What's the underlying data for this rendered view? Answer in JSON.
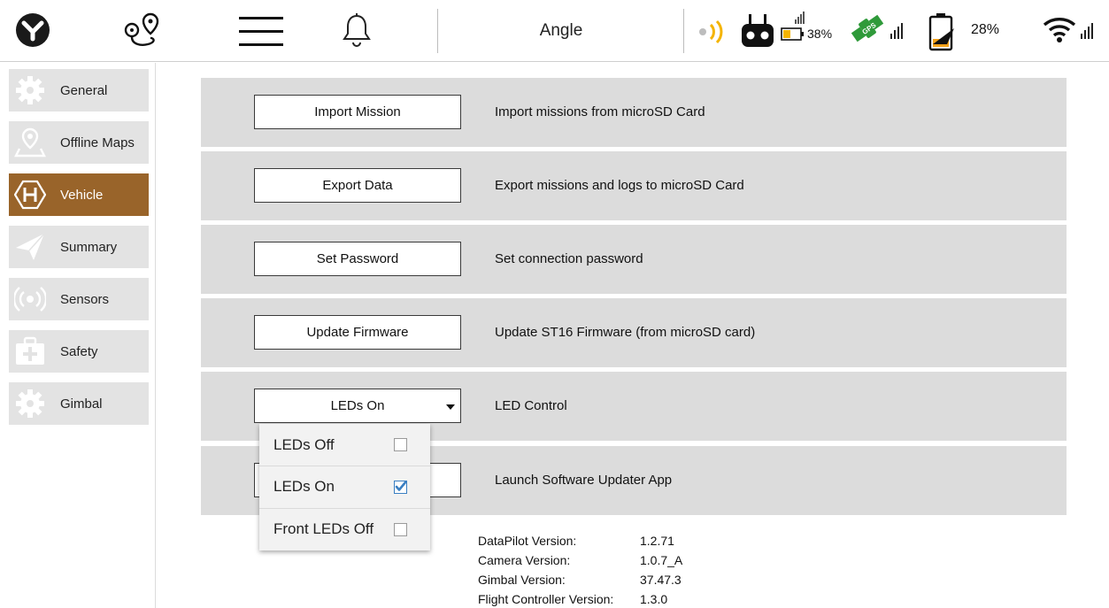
{
  "header": {
    "title": "Angle",
    "status": {
      "remote_battery": "38%",
      "gps_label": "GPS",
      "device_battery": "28%"
    },
    "colors": {
      "accent": "#99642a",
      "battery_low": "#f4b400",
      "gps_green": "#2f9a3a",
      "check_blue": "#3a7fc2"
    }
  },
  "sidebar": {
    "items": [
      {
        "label": "General",
        "icon": "gear-icon",
        "active": false
      },
      {
        "label": "Offline Maps",
        "icon": "map-pin-icon",
        "active": false
      },
      {
        "label": "Vehicle",
        "icon": "hexacopter-icon",
        "active": true
      },
      {
        "label": "Summary",
        "icon": "paper-plane-icon",
        "active": false
      },
      {
        "label": "Sensors",
        "icon": "broadcast-icon",
        "active": false
      },
      {
        "label": "Safety",
        "icon": "first-aid-kit-icon",
        "active": false
      },
      {
        "label": "Gimbal",
        "icon": "gear-icon",
        "active": false
      }
    ]
  },
  "main": {
    "rows": [
      {
        "button": "Import Mission",
        "description": "Import missions from microSD Card"
      },
      {
        "button": "Export Data",
        "description": "Export missions and logs to microSD Card"
      },
      {
        "button": "Set Password",
        "description": "Set connection password"
      },
      {
        "button": "Update Firmware",
        "description": "Update ST16 Firmware (from microSD card)"
      },
      {
        "select_value": "LEDs On",
        "description": "LED Control"
      },
      {
        "button": "",
        "description": "Launch Software Updater App"
      }
    ],
    "led_menu": {
      "options": [
        {
          "label": "LEDs Off",
          "checked": false
        },
        {
          "label": "LEDs On",
          "checked": true
        },
        {
          "label": "Front LEDs Off",
          "checked": false
        }
      ]
    },
    "versions": [
      {
        "label": "DataPilot Version:",
        "value": "1.2.71"
      },
      {
        "label": "Camera Version:",
        "value": "1.0.7_A"
      },
      {
        "label": "Gimbal Version:",
        "value": "37.47.3"
      },
      {
        "label": "Flight Controller Version:",
        "value": "1.3.0"
      }
    ]
  }
}
